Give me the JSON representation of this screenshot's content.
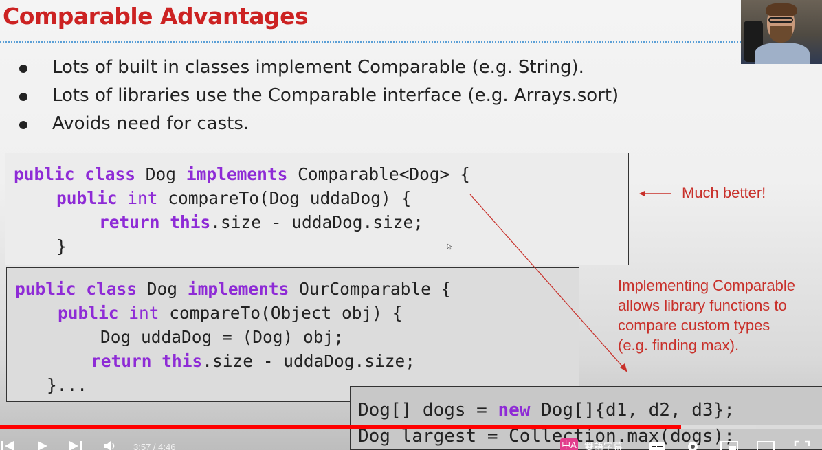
{
  "slide": {
    "title": "Comparable Advantages",
    "bullets": [
      "Lots of built in classes implement Comparable (e.g. String).",
      "Lots of libraries use the Comparable interface (e.g. Arrays.sort)",
      "Avoids need for casts."
    ],
    "code_box_1": {
      "l1_kw1": "public",
      "l1_kw2": "class",
      "l1_a": " Dog ",
      "l1_kw3": "implements",
      "l1_b": " Comparable<Dog> {",
      "l2_kw1": "public",
      "l2_kw2": "int",
      "l2_a": " compareTo(Dog uddaDog) {",
      "l3_kw1": "return",
      "l3_kw2": "this",
      "l3_a": ".size - uddaDog.size;",
      "l4": "}"
    },
    "code_box_2": {
      "l1_kw1": "public",
      "l1_kw2": "class",
      "l1_a": " Dog ",
      "l1_kw3": "implements",
      "l1_b": " OurComparable {",
      "l2_kw1": "public",
      "l2_kw2": "int",
      "l2_a": " compareTo(Object obj) {",
      "l3": "Dog uddaDog = (Dog) obj;",
      "l4_kw1": "return",
      "l4_kw2": "this",
      "l4_a": ".size - uddaDog.size;",
      "l5": "}..."
    },
    "code_box_3": {
      "l1_a": "Dog[] dogs = ",
      "l1_kw": "new",
      "l1_b": " Dog[]{d1, d2, d3};",
      "l2": "Dog largest = Collection.max(dogs);"
    },
    "annotation_much_better": "Much better!",
    "annotation_implementing": [
      "Implementing Comparable",
      "allows library functions to",
      "compare custom types",
      "(e.g. finding max)."
    ]
  },
  "player": {
    "time_display": "3:57 / 4:46",
    "progress_fraction": 0.829,
    "buffered_fraction": 0.92,
    "subtitle_badge": "中A",
    "subtitle_label": "雙語字幕"
  },
  "colors": {
    "title": "#cc2222",
    "keyword": "#8e2bd6",
    "annotation": "#c8302a",
    "progress": "#ff0000",
    "rule": "#5a9fd6"
  }
}
